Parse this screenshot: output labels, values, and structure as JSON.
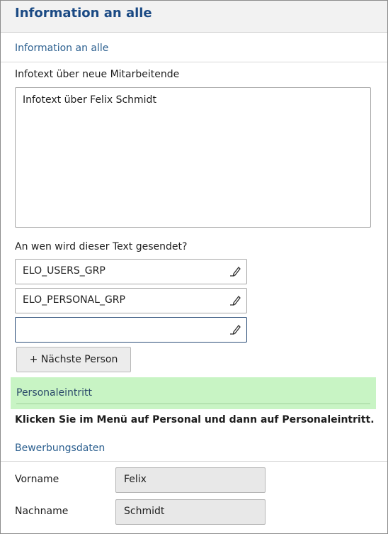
{
  "header": {
    "title": "Information an alle"
  },
  "section_info": {
    "title": "Information an alle"
  },
  "infotext": {
    "label": "Infotext über neue Mitarbeitende",
    "value": "Infotext über Felix Schmidt"
  },
  "recipients": {
    "label": "An wen wird dieser Text gesendet?",
    "entries": [
      "ELO_USERS_GRP",
      "ELO_PERSONAL_GRP",
      ""
    ],
    "next_button": "+ Nächste Person"
  },
  "personal": {
    "title": "Personaleintritt",
    "hint": "Klicken Sie im Menü auf Personal und dann auf Personaleintritt."
  },
  "application": {
    "title": "Bewerbungsdaten",
    "first_name_label": "Vorname",
    "first_name_value": "Felix",
    "last_name_label": "Nachname",
    "last_name_value": "Schmidt"
  },
  "colors": {
    "header_text": "#1b4a84",
    "section_text": "#2b5f8f",
    "highlight_bg": "#c8f4c4"
  }
}
